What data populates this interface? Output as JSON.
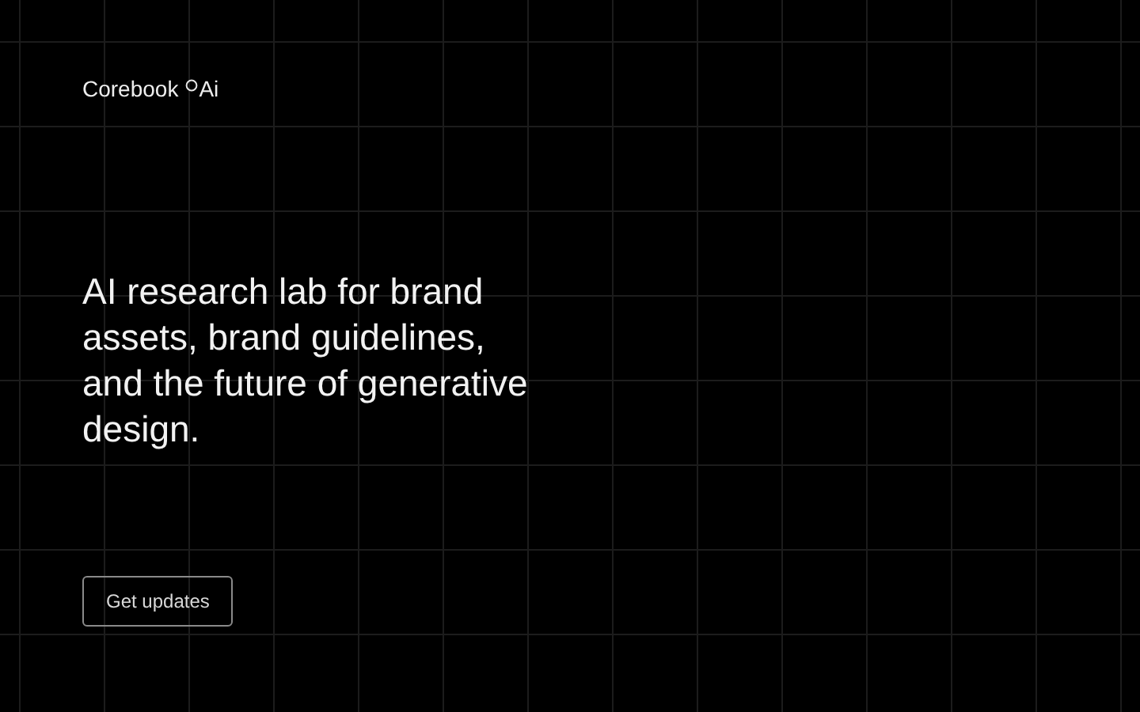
{
  "brand": {
    "name": "Corebook",
    "suffix": "Ai"
  },
  "headline": {
    "lines": [
      "AI research lab for brand",
      "assets, brand guidelines,",
      "and the future of generative",
      "design."
    ]
  },
  "cta": {
    "label": "Get updates"
  }
}
